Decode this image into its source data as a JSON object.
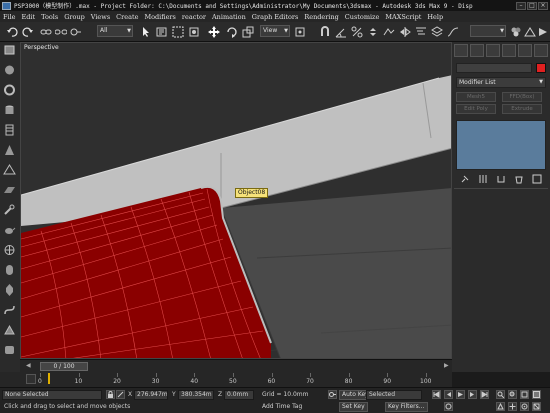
{
  "window": {
    "title": "PSP3000（模型制作）.max    - Project Folder: C:\\Documents and Settings\\Administrator\\My Documents\\3dsmax    - Autodesk 3ds Max 9    - Disp",
    "controls": [
      "–",
      "□",
      "×"
    ]
  },
  "menu": [
    "File",
    "Edit",
    "Tools",
    "Group",
    "Views",
    "Create",
    "Modifiers",
    "reactor",
    "Animation",
    "Graph Editors",
    "Rendering",
    "Customize",
    "MAXScript",
    "Help"
  ],
  "toolbar": {
    "selection_filter": "All",
    "reference_coord": "View",
    "icons": [
      "undo-icon",
      "redo-icon",
      "link-icon",
      "unlink-icon",
      "bind-icon",
      "select-icon",
      "select-by-name-icon",
      "region-select-icon",
      "window-crossing-icon",
      "move-icon",
      "rotate-icon",
      "scale-icon",
      "pivot-icon",
      "snap-icon",
      "angle-snap-icon",
      "percent-snap-icon",
      "spinner-snap-icon",
      "named-selection-icon",
      "mirror-icon",
      "align-icon",
      "layer-icon",
      "curve-editor-icon",
      "schematic-icon",
      "material-editor-icon",
      "render-scene-icon",
      "quick-render-icon"
    ]
  },
  "viewport": {
    "label": "Perspective",
    "tooltip": "Object08",
    "colors": {
      "background": "#2f2f2f",
      "surface": "#c0c0c0",
      "wall": "#4a4a4a",
      "mesh": "#8a0000",
      "wire": "#e24b4b"
    }
  },
  "command_panel": {
    "tabs": [
      "create-tab",
      "modify-tab",
      "hierarchy-tab",
      "motion-tab",
      "display-tab",
      "utilities-tab"
    ],
    "modifier_list": "Modifier List",
    "buttons": [
      "Mesh5",
      "FFD(Box)",
      "Edit Poly",
      "Extrude"
    ],
    "swatch_color": "#e02020"
  },
  "timeline": {
    "frame": "0 / 100",
    "ticks": [
      0,
      10,
      20,
      30,
      40,
      50,
      60,
      70,
      80,
      90,
      100
    ]
  },
  "status": {
    "selection": "None Selected",
    "prompt": "Click and drag to select and move objects",
    "x": "276.947m",
    "y": "380.354m",
    "z": "0.0mm",
    "x_label": "X",
    "y_label": "Y",
    "z_label": "Z",
    "grid": "Grid = 10.0mm",
    "auto_key": "Auto Key",
    "set_key": "Set Key",
    "selected_dropdown": "Selected",
    "key_filters": "Key Filters...",
    "add_time_tag": "Add Time Tag"
  }
}
